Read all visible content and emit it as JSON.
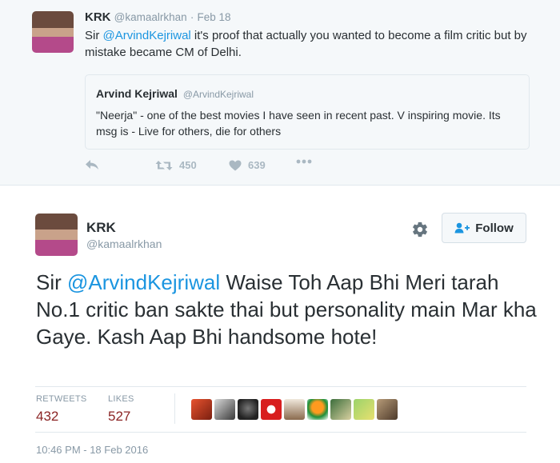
{
  "top_tweet": {
    "name": "KRK",
    "handle": "@kamaalrkhan",
    "separator": "·",
    "date": "Feb 18",
    "text_prefix": "Sir ",
    "mention": "@ArvindKejriwal",
    "text_suffix": " it's proof that actually you wanted to become a film critic but by mistake became CM of Delhi.",
    "quote": {
      "name": "Arvind Kejriwal",
      "handle": "@ArvindKejriwal",
      "text": "\"Neerja\" - one of the best movies I have seen in recent past. V inspiring movie. Its msg is - Live for others, die for others"
    },
    "actions": {
      "reply_icon": "reply-icon",
      "retweet_icon": "retweet-icon",
      "retweet_count": "450",
      "like_icon": "heart-icon",
      "like_count": "639",
      "more_icon": "more-dots-icon"
    }
  },
  "main_tweet": {
    "name": "KRK",
    "handle": "@kamaalrkhan",
    "follow_label": "Follow",
    "text_prefix": "Sir ",
    "mention": "@ArvindKejriwal",
    "text_suffix": " Waise Toh Aap Bhi Meri tarah No.1 critic ban sakte thai but personality main Mar kha Gaye. Kash Aap Bhi handsome hote!",
    "stats": {
      "retweets_label": "RETWEETS",
      "retweets_value": "432",
      "likes_label": "LIKES",
      "likes_value": "527"
    },
    "likers_count": 9,
    "timestamp": "10:46 PM - 18 Feb 2016"
  },
  "colors": {
    "mention": "#1b95e0",
    "stat_value": "#8b2424",
    "muted": "#8899a6",
    "background_top": "#f5f8fa"
  }
}
